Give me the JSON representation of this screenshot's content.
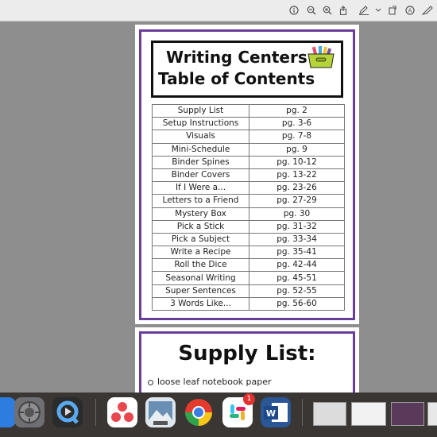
{
  "toolbar": {
    "icons": [
      "info-icon",
      "zoom-out-icon",
      "zoom-in-icon",
      "share-icon",
      "markup-pen-icon",
      "chevron-down-icon",
      "rotate-icon",
      "highlight-icon",
      "sidebar-icon"
    ]
  },
  "page1": {
    "title_line1": "Writing Centers",
    "title_line2": "Table of Contents",
    "toc": [
      {
        "section": "Supply List",
        "pages": "pg. 2"
      },
      {
        "section": "Setup Instructions",
        "pages": "pg. 3-6"
      },
      {
        "section": "Visuals",
        "pages": "pg. 7-8"
      },
      {
        "section": "Mini-Schedule",
        "pages": "pg. 9"
      },
      {
        "section": "Binder Spines",
        "pages": "pg. 10-12"
      },
      {
        "section": "Binder Covers",
        "pages": "pg. 13-22"
      },
      {
        "section": "If I Were a...",
        "pages": "pg. 23-26"
      },
      {
        "section": "Letters to a Friend",
        "pages": "pg. 27-29"
      },
      {
        "section": "Mystery Box",
        "pages": "pg. 30"
      },
      {
        "section": "Pick a Stick",
        "pages": "pg. 31-32"
      },
      {
        "section": "Pick a Subject",
        "pages": "pg. 33-34"
      },
      {
        "section": "Write a Recipe",
        "pages": "pg. 35-41"
      },
      {
        "section": "Roll the Dice",
        "pages": "pg. 42-44"
      },
      {
        "section": "Seasonal Writing",
        "pages": "pg. 45-51"
      },
      {
        "section": "Super Sentences",
        "pages": "pg. 52-55"
      },
      {
        "section": "3 Words Like...",
        "pages": "pg. 56-60"
      }
    ]
  },
  "page2": {
    "heading": "Supply List:",
    "items": [
      "loose leaf notebook paper"
    ]
  },
  "dock": {
    "slack_badge": "1",
    "apps": [
      "finder-icon",
      "system-preferences-icon",
      "quicktime-icon",
      "asana-icon",
      "preview-icon",
      "chrome-icon",
      "slack-icon",
      "word-icon"
    ]
  },
  "colors": {
    "frame_purple": "#6a3d9a",
    "viewer_background": "#8e8e8e"
  }
}
